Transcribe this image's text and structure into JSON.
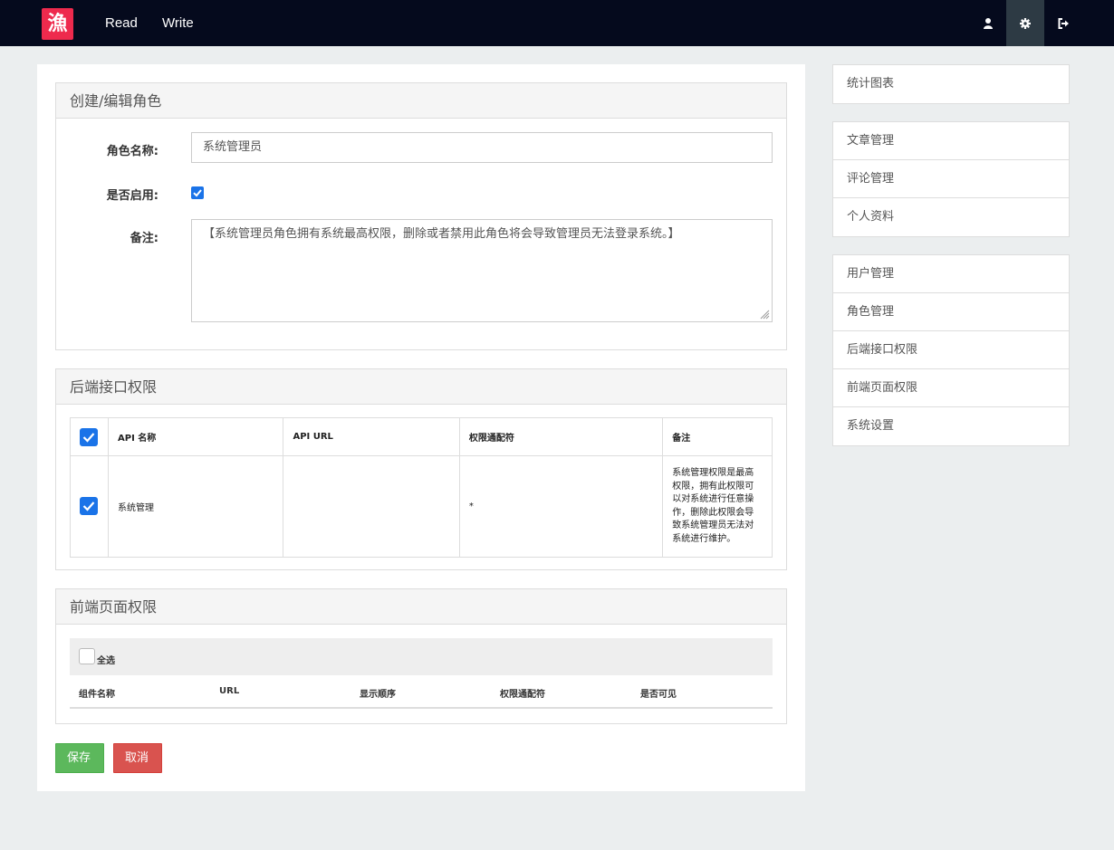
{
  "nav": {
    "logo_char": "漁",
    "read": "Read",
    "write": "Write",
    "icons": [
      "user-icon",
      "gear-icon",
      "sign-out-icon"
    ]
  },
  "role_panel": {
    "title": "创建/编辑角色",
    "name_label": "角色名称:",
    "name_value": "系统管理员",
    "enabled_label": "是否启用:",
    "enabled": true,
    "note_label": "备注:",
    "note_value": "【系统管理员角色拥有系统最高权限，删除或者禁用此角色将会导致管理员无法登录系统。】"
  },
  "api_panel": {
    "title": "后端接口权限",
    "columns": [
      "API 名称",
      "API URL",
      "权限通配符",
      "备注"
    ],
    "rows": [
      {
        "checked": true,
        "name": "系统管理",
        "url": "",
        "wildcard": "*",
        "note": "系统管理权限是最高权限，拥有此权限可以对系统进行任意操作，删除此权限会导致系统管理员无法对系统进行维护。"
      }
    ]
  },
  "frontend_panel": {
    "title": "前端页面权限",
    "select_all": "全选",
    "columns": [
      "组件名称",
      "URL",
      "显示顺序",
      "权限通配符",
      "是否可见"
    ]
  },
  "buttons": {
    "save": "保存",
    "cancel": "取消"
  },
  "sidebar": {
    "group1": [
      "统计图表"
    ],
    "group2": [
      "文章管理",
      "评论管理",
      "个人资料"
    ],
    "group3": [
      "用户管理",
      "角色管理",
      "后端接口权限",
      "前端页面权限",
      "系统设置"
    ]
  },
  "colors": {
    "navbar": "#050a1d",
    "logo": "#ee2a4d",
    "checkbox": "#1a73e8",
    "save": "#5cb85c",
    "cancel": "#d9534f"
  }
}
